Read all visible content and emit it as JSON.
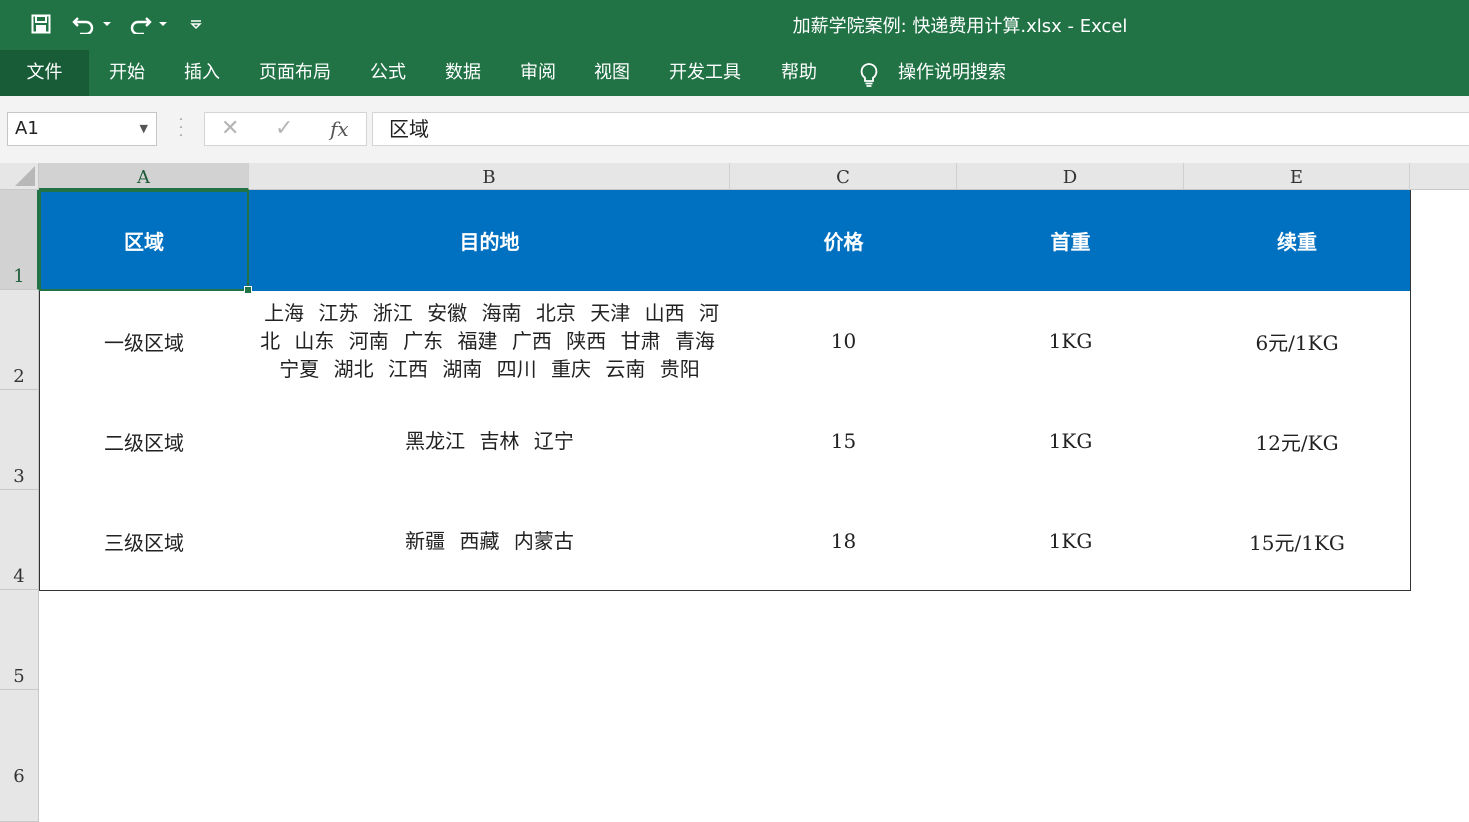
{
  "title_bar": {
    "document_title": "加薪学院案例: 快递费用计算.xlsx  -  Excel",
    "quick_access": [
      "save-icon",
      "undo-icon",
      "redo-icon",
      "customize-dropdown-icon"
    ]
  },
  "ribbon": {
    "tabs": [
      "文件",
      "开始",
      "插入",
      "页面布局",
      "公式",
      "数据",
      "审阅",
      "视图",
      "开发工具",
      "帮助"
    ],
    "tell_me": "操作说明搜索",
    "accent": "#217346"
  },
  "formula_bar": {
    "name_box": "A1",
    "fx_label": "fx",
    "content": "区域"
  },
  "sheet": {
    "columns": [
      "A",
      "B",
      "C",
      "D",
      "E"
    ],
    "rows": [
      "1",
      "2",
      "3",
      "4",
      "5",
      "6"
    ],
    "header_fill": "#0070c0",
    "header": [
      "区域",
      "目的地",
      "价格",
      "首重",
      "续重"
    ],
    "data": [
      {
        "region": "一级区域",
        "destinations": [
          "上海",
          "江苏",
          "浙江",
          "安徽",
          "海南",
          "北京",
          "天津",
          "山西",
          "河北",
          "山东",
          "河南",
          "广东",
          "福建",
          "广西",
          "陕西",
          "甘肃",
          "青海",
          "宁夏",
          "湖北",
          "江西",
          "湖南",
          "四川",
          "重庆",
          "云南",
          "贵阳"
        ],
        "price": "10",
        "first_weight": "1KG",
        "extra_weight": "6元/1KG"
      },
      {
        "region": "二级区域",
        "destinations": [
          "黑龙江",
          "吉林",
          "辽宁"
        ],
        "price": "15",
        "first_weight": "1KG",
        "extra_weight": "12元/KG"
      },
      {
        "region": "三级区域",
        "destinations": [
          "新疆",
          "西藏",
          "内蒙古"
        ],
        "price": "18",
        "first_weight": "1KG",
        "extra_weight": "15元/1KG"
      }
    ]
  }
}
